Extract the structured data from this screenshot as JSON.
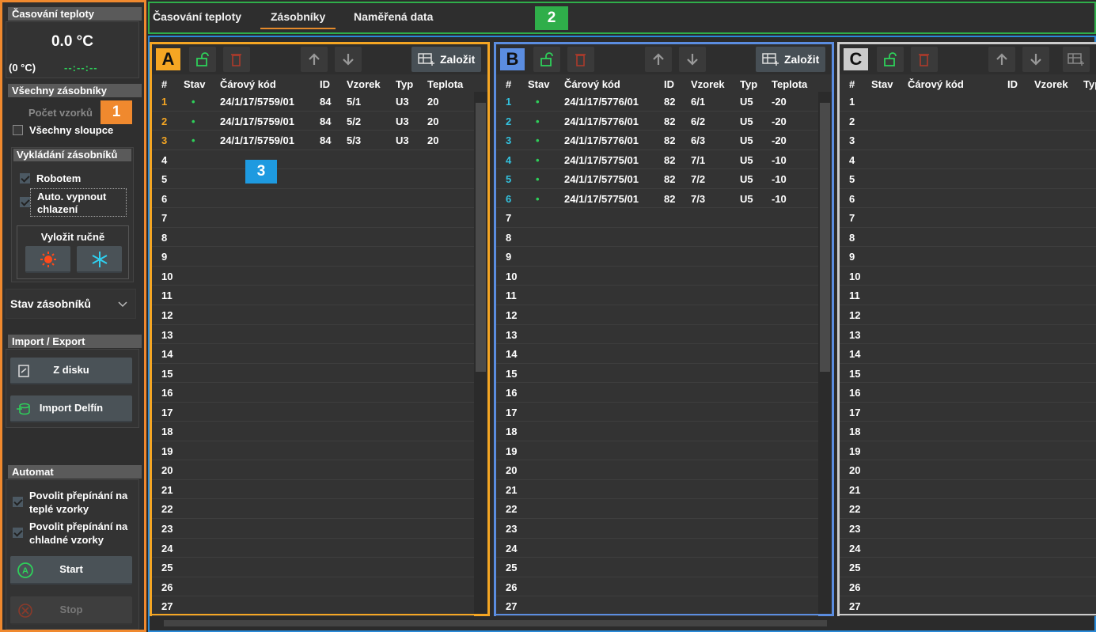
{
  "left": {
    "temp_section": {
      "title": "Časování teploty",
      "value": "0.0 °C",
      "sub": "(0 °C)",
      "timer": "--:--:--"
    },
    "all_section": {
      "title": "Všechny zásobníky",
      "count_label": "Počet vzorků",
      "all_columns": "Všechny sloupce"
    },
    "unload": {
      "title": "Vykládání zásobníků",
      "robot": "Robotem",
      "auto_off": "Auto. vypnout chlazení",
      "manual_title": "Vyložit ručně"
    },
    "status_dropdown": "Stav zásobníků",
    "import_export": {
      "title": "Import / Export",
      "disk": "Z disku",
      "delfin": "Import Delfín"
    },
    "automat": {
      "title": "Automat",
      "warm": "Povolit přepínání na teplé vzorky",
      "cold": "Povolit přepínání na chladné vzorky",
      "start": "Start",
      "stop": "Stop"
    }
  },
  "badges": {
    "b1": "1",
    "b2": "2",
    "b3": "3"
  },
  "tabs": [
    "Časování teploty",
    "Zásobníky",
    "Naměřená data"
  ],
  "columns": [
    "#",
    "Stav",
    "Čárový kód",
    "ID",
    "Vzorek",
    "Typ",
    "Teplota"
  ],
  "zalozit": "Založit",
  "panels": [
    {
      "letter": "A",
      "color": "#f5a623",
      "numcolor": "#f5a623",
      "rows": [
        {
          "n": "1",
          "stav": "•",
          "code": "24/1/17/5759/01",
          "id": "84",
          "vz": "5/1",
          "typ": "U3",
          "t": "20"
        },
        {
          "n": "2",
          "stav": "•",
          "code": "24/1/17/5759/01",
          "id": "84",
          "vz": "5/2",
          "typ": "U3",
          "t": "20"
        },
        {
          "n": "3",
          "stav": "•",
          "code": "24/1/17/5759/01",
          "id": "84",
          "vz": "5/3",
          "typ": "U3",
          "t": "20"
        }
      ]
    },
    {
      "letter": "B",
      "color": "#5b8de0",
      "numcolor": "#33c3e0",
      "rows": [
        {
          "n": "1",
          "stav": "•",
          "code": "24/1/17/5776/01",
          "id": "82",
          "vz": "6/1",
          "typ": "U5",
          "t": "-20"
        },
        {
          "n": "2",
          "stav": "•",
          "code": "24/1/17/5776/01",
          "id": "82",
          "vz": "6/2",
          "typ": "U5",
          "t": "-20"
        },
        {
          "n": "3",
          "stav": "•",
          "code": "24/1/17/5776/01",
          "id": "82",
          "vz": "6/3",
          "typ": "U5",
          "t": "-20"
        },
        {
          "n": "4",
          "stav": "•",
          "code": "24/1/17/5775/01",
          "id": "82",
          "vz": "7/1",
          "typ": "U5",
          "t": "-10"
        },
        {
          "n": "5",
          "stav": "•",
          "code": "24/1/17/5775/01",
          "id": "82",
          "vz": "7/2",
          "typ": "U5",
          "t": "-10"
        },
        {
          "n": "6",
          "stav": "•",
          "code": "24/1/17/5775/01",
          "id": "82",
          "vz": "7/3",
          "typ": "U5",
          "t": "-10"
        }
      ]
    },
    {
      "letter": "C",
      "color": "#cccccc",
      "numcolor": "#dddddd",
      "rows": []
    }
  ],
  "row_count": 27
}
